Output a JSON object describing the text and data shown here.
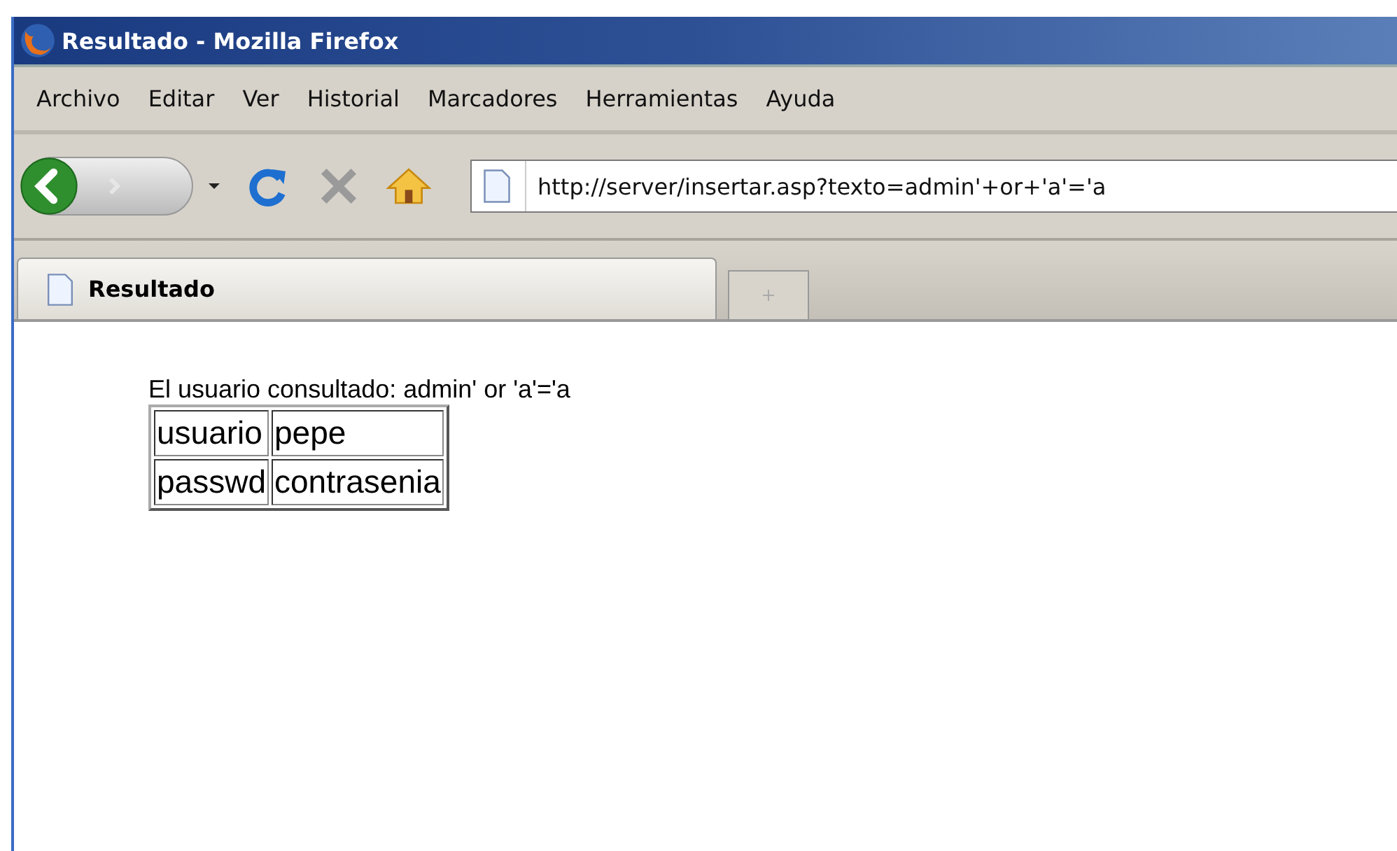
{
  "window": {
    "title": "Resultado - Mozilla Firefox"
  },
  "menu": [
    "Archivo",
    "Editar",
    "Ver",
    "Historial",
    "Marcadores",
    "Herramientas",
    "Ayuda"
  ],
  "address_bar": {
    "value": "http://server/insertar.asp?texto=admin'+or+'a'='a"
  },
  "tabs": [
    {
      "label": "Resultado",
      "selected": true
    }
  ],
  "page": {
    "intro": "El usuario consultado: admin' or 'a'='a",
    "table": [
      [
        "usuario",
        "pepe"
      ],
      [
        "passwd",
        "contrasenia"
      ]
    ]
  }
}
